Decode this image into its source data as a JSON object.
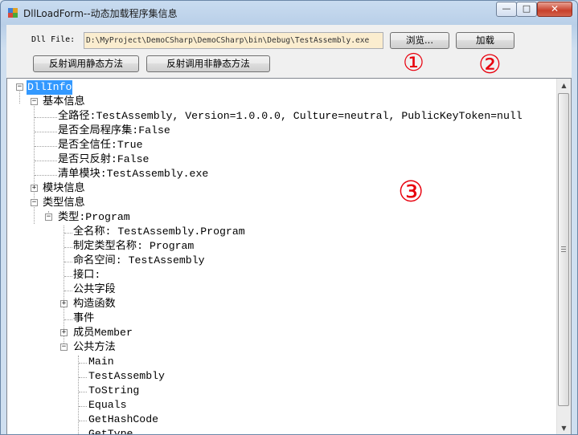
{
  "window": {
    "title": "DllLoadForm--动态加载程序集信息",
    "minimize": "—",
    "maximize": "□",
    "close": "✕"
  },
  "form": {
    "dll_label": "Dll File:",
    "dll_path": "D:\\MyProject\\DemoCSharp\\DemoCSharp\\bin\\Debug\\TestAssembly.exe",
    "browse_label": "浏览...",
    "load_label": "加载",
    "static_method_label": "反射调用静态方法",
    "instance_method_label": "反射调用非静态方法"
  },
  "tree": {
    "root": "DllInfo",
    "basic": "基本信息",
    "full_path": "全路径:TestAssembly, Version=1.0.0.0, Culture=neutral, PublicKeyToken=null",
    "gac": "是否全局程序集:False",
    "full_trust": "是否全信任:True",
    "reflection_only": "是否只反射:False",
    "manifest_module": "清单模块:TestAssembly.exe",
    "module_info": "模块信息",
    "type_info": "类型信息",
    "type_program": "类型:Program",
    "full_name": "全名称: TestAssembly.Program",
    "type_name": "制定类型名称: Program",
    "namespace": "命名空间: TestAssembly",
    "interfaces": "接口:",
    "public_fields": "公共字段",
    "constructors": "构造函数",
    "events": "事件",
    "members": "成员Member",
    "public_methods": "公共方法",
    "methods": [
      "Main",
      "TestAssembly",
      "ToString",
      "Equals",
      "GetHashCode",
      "GetType"
    ]
  },
  "annotations": {
    "one": "①",
    "two": "②",
    "three": "③"
  },
  "colors": {
    "selection": "#3399ff",
    "path_bg": "#fbedcf",
    "annotation": "#e8000d"
  }
}
